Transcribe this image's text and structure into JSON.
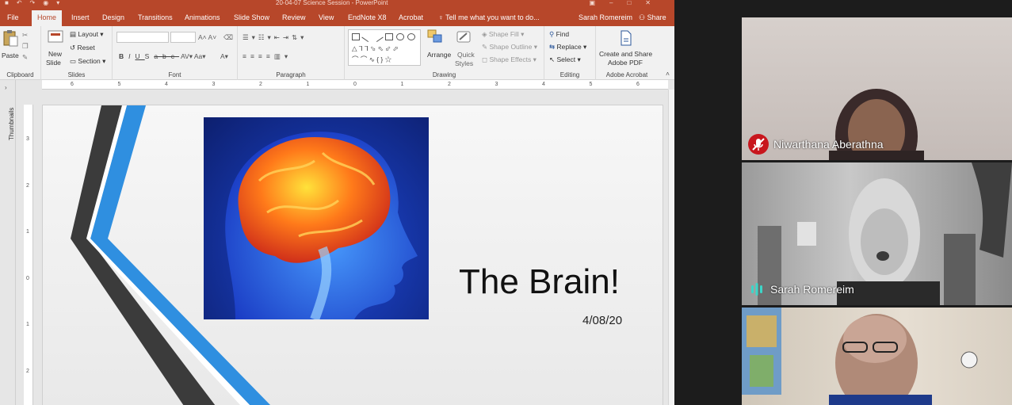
{
  "window": {
    "title": "20-04-07 Science Session - PowerPoint"
  },
  "tabs": [
    {
      "label": "File"
    },
    {
      "label": "Home"
    },
    {
      "label": "Insert"
    },
    {
      "label": "Design"
    },
    {
      "label": "Transitions"
    },
    {
      "label": "Animations"
    },
    {
      "label": "Slide Show"
    },
    {
      "label": "Review"
    },
    {
      "label": "View"
    },
    {
      "label": "EndNote X8"
    },
    {
      "label": "Acrobat"
    }
  ],
  "tell_me": "Tell me what you want to do...",
  "user_name": "Sarah Romereim",
  "share_label": "Share",
  "ribbon": {
    "clipboard": {
      "paste": "Paste",
      "label": "Clipboard"
    },
    "slides": {
      "new_slide_line1": "New",
      "new_slide_line2": "Slide",
      "layout": "Layout",
      "reset": "Reset",
      "section": "Section",
      "label": "Slides"
    },
    "font": {
      "label": "Font"
    },
    "paragraph": {
      "label": "Paragraph"
    },
    "drawing": {
      "arrange": "Arrange",
      "quick_styles_line1": "Quick",
      "quick_styles_line2": "Styles",
      "shape_fill": "Shape Fill",
      "shape_outline": "Shape Outline",
      "shape_effects": "Shape Effects",
      "label": "Drawing"
    },
    "editing": {
      "find": "Find",
      "replace": "Replace",
      "select": "Select",
      "label": "Editing"
    },
    "acrobat": {
      "create_line1": "Create and Share",
      "create_line2": "Adobe PDF",
      "label": "Adobe Acrobat"
    }
  },
  "thumbnails_label": "Thumbnails",
  "ruler_numbers": [
    "6",
    "5",
    "4",
    "3",
    "2",
    "1",
    "0",
    "1",
    "2",
    "3",
    "4",
    "5",
    "6"
  ],
  "vruler_numbers": [
    "3",
    "2",
    "1",
    "0",
    "1",
    "2"
  ],
  "slide": {
    "title": "The Brain!",
    "date": "4/08/20"
  },
  "participants": [
    {
      "name": "Niwarthana Aberathna",
      "status": "muted"
    },
    {
      "name": "Sarah Romereim",
      "status": "speaking"
    },
    {
      "name": "",
      "status": "video"
    }
  ],
  "colors": {
    "ppt_accent": "#b7472a",
    "mute_red": "#c8161d",
    "speaking_teal": "#3dd6c8"
  }
}
